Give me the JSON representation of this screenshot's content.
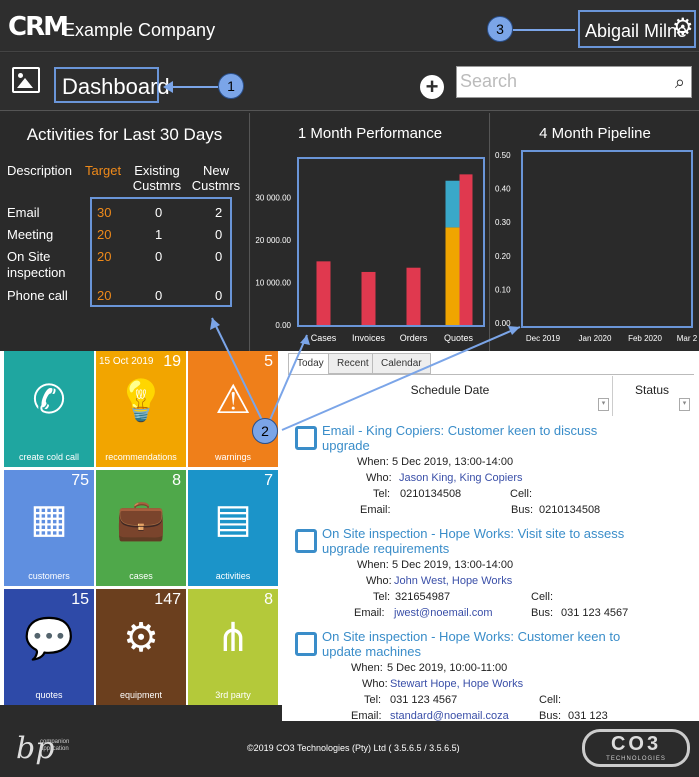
{
  "header": {
    "logo": "CRM",
    "company": "Example Company",
    "username": "Abigail Milne"
  },
  "callouts": [
    "1",
    "2",
    "3"
  ],
  "toolbar": {
    "title": "Dashboard",
    "search_placeholder": "Search"
  },
  "activities": {
    "title": "Activities for Last 30 Days",
    "col_description": "Description",
    "col_target": "Target",
    "col_existing": "Existing Custmrs",
    "col_new": "New Custmrs",
    "rows": [
      {
        "description": "Email",
        "target": "30",
        "existing": "0",
        "new": "2"
      },
      {
        "description": "Meeting",
        "target": "20",
        "existing": "1",
        "new": "0"
      },
      {
        "description": "On Site inspection",
        "target": "20",
        "existing": "0",
        "new": "0"
      },
      {
        "description": "Phone call",
        "target": "20",
        "existing": "0",
        "new": "0"
      }
    ]
  },
  "performance": {
    "title": "1 Month Performance"
  },
  "pipeline": {
    "title": "4 Month Pipeline"
  },
  "chart_data": [
    {
      "type": "bar",
      "title": "1 Month Performance",
      "categories": [
        "Cases",
        "Invoices",
        "Orders",
        "Quotes"
      ],
      "yticks": [
        "30 000.00",
        "20 000.00",
        "10 000.00",
        "0.00"
      ],
      "ylim": [
        0,
        37000
      ],
      "series": [
        {
          "color": "#e0394f",
          "values": [
            15000,
            12500,
            13500,
            0
          ]
        },
        {
          "color": "#e0394f",
          "values": [
            0,
            0,
            0,
            35500
          ]
        },
        {
          "color": "#f0a500",
          "values": [
            0,
            0,
            0,
            23000
          ]
        },
        {
          "color": "#3aa8c9",
          "values": [
            0,
            0,
            0,
            11000
          ]
        }
      ],
      "stack_order": "quotes bar: yellow 23000 at base, cyan 11000 above on left; red 35500 right",
      "grid": false
    },
    {
      "type": "line",
      "title": "4 Month Pipeline",
      "categories": [
        "Dec 2019",
        "Jan 2020",
        "Feb 2020",
        "Mar 2"
      ],
      "yticks": [
        "0.50",
        "0.40",
        "0.30",
        "0.20",
        "0.10",
        "0.00"
      ],
      "ylim": [
        0,
        0.5
      ],
      "series": [],
      "grid": false
    }
  ],
  "tiles": [
    {
      "label": "create cold call",
      "count": "",
      "date": "",
      "color": "#1fa6a0",
      "icon": "phone-icon"
    },
    {
      "label": "recommendations",
      "count": "19",
      "date": "15 Oct 2019",
      "color": "#f2a500",
      "icon": "lightbulb-icon"
    },
    {
      "label": "warnings",
      "count": "5",
      "date": "",
      "color": "#ef7f1a",
      "icon": "warning-icon"
    },
    {
      "label": "customers",
      "count": "75",
      "date": "",
      "color": "#5f8fe0",
      "icon": "building-icon"
    },
    {
      "label": "cases",
      "count": "8",
      "date": "",
      "color": "#4fa84a",
      "icon": "briefcase-icon"
    },
    {
      "label": "activities",
      "count": "7",
      "date": "",
      "color": "#1b94c9",
      "icon": "calendar-icon"
    },
    {
      "label": "quotes",
      "count": "15",
      "date": "",
      "color": "#2e4aa8",
      "icon": "chat-icon"
    },
    {
      "label": "equipment",
      "count": "147",
      "date": "",
      "color": "#6b3f1e",
      "icon": "gears-icon"
    },
    {
      "label": "3rd party",
      "count": "8",
      "date": "",
      "color": "#b4c93a",
      "icon": "share-icon"
    }
  ],
  "schedule": {
    "tabs": [
      "Today",
      "Recent",
      "Calendar"
    ],
    "col_date": "Schedule Date",
    "col_status": "Status",
    "items": [
      {
        "title": "Email - King Copiers: Customer keen to discuss upgrade",
        "when_label": "When:",
        "when": "5 Dec 2019, 13:00-14:00",
        "who_label": "Who:",
        "who": "Jason King, King Copiers",
        "tel_label": "Tel:",
        "tel": "0210134508",
        "cell_label": "Cell:",
        "cell": "",
        "email_label": "Email:",
        "email": "",
        "bus_label": "Bus:",
        "bus": "0210134508"
      },
      {
        "title": "On Site inspection - Hope Works: Visit site to assess upgrade requirements",
        "when_label": "When:",
        "when": "5 Dec 2019, 13:00-14:00",
        "who_label": "Who:",
        "who": "John West, Hope Works",
        "tel_label": "Tel:",
        "tel": "321654987",
        "cell_label": "Cell:",
        "cell": "",
        "email_label": "Email:",
        "email": "jwest@noemail.com",
        "bus_label": "Bus:",
        "bus": "031 123 4567"
      },
      {
        "title": "On Site inspection - Hope Works: Customer keen to update machines",
        "when_label": "When:",
        "when": "5 Dec 2019, 10:00-11:00",
        "who_label": "Who:",
        "who": "Stewart Hope, Hope Works",
        "tel_label": "Tel:",
        "tel": "031 123 4567",
        "cell_label": "Cell:",
        "cell": "",
        "email_label": "Email:",
        "email": "standard@noemail.coza",
        "bus_label": "Bus:",
        "bus": "031 123"
      }
    ]
  },
  "footer": {
    "badge_line1": "companion",
    "badge_line2": "application",
    "copyright": "©2019 CO3 Technologies (Pty) Ltd ( 3.5.6.5 / 3.5.6.5)",
    "brand": "CO3",
    "brand_sub": "TECHNOLOGIES"
  }
}
